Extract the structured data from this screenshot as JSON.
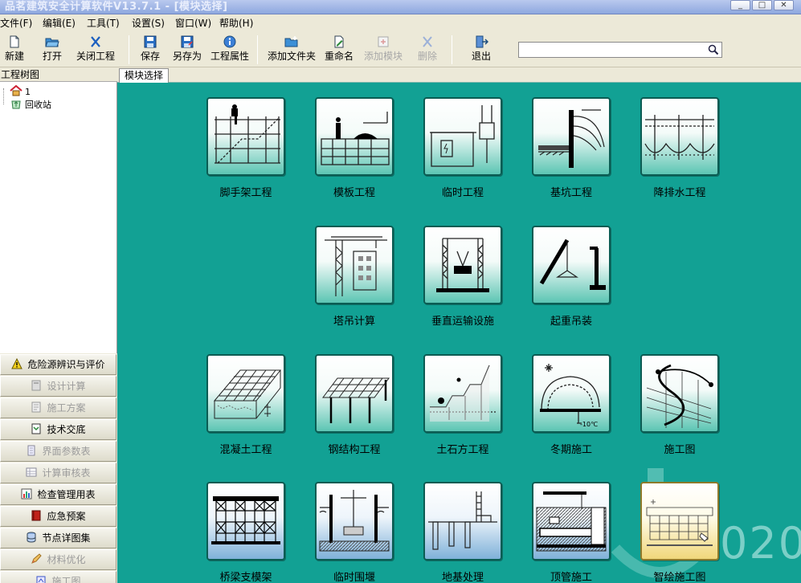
{
  "window": {
    "title": "品茗建筑安全计算软件V13.7.1 - [模块选择]",
    "controls": [
      "_",
      "□",
      "✕"
    ]
  },
  "menu": [
    "文件(F)",
    "编辑(E)",
    "工具(T)",
    "设置(S)",
    "窗口(W)",
    "帮助(H)"
  ],
  "toolbar": {
    "new": "新建",
    "open": "打开",
    "close_project": "关闭工程",
    "save": "保存",
    "save_as": "另存为",
    "properties": "工程属性",
    "add_folder": "添加文件夹",
    "rename": "重命名",
    "add_module": "添加模块",
    "delete": "删除",
    "exit": "退出"
  },
  "search": {
    "value": "",
    "placeholder": ""
  },
  "tree": {
    "header": "工程树图",
    "nodes": [
      "1",
      "回收站"
    ]
  },
  "nav": [
    {
      "label": "危险源辨识与评价",
      "enabled": true,
      "icon": "warning-icon"
    },
    {
      "label": "设计计算",
      "enabled": false,
      "icon": "calculator-icon"
    },
    {
      "label": "施工方案",
      "enabled": false,
      "icon": "plan-icon"
    },
    {
      "label": "技术交底",
      "enabled": true,
      "icon": "document-icon"
    },
    {
      "label": "界面参数表",
      "enabled": false,
      "icon": "scroll-icon"
    },
    {
      "label": "计算审核表",
      "enabled": false,
      "icon": "table-icon"
    },
    {
      "label": "检查管理用表",
      "enabled": true,
      "icon": "chart-icon"
    },
    {
      "label": "应急预案",
      "enabled": true,
      "icon": "book-icon"
    },
    {
      "label": "节点详图集",
      "enabled": true,
      "icon": "database-icon"
    },
    {
      "label": "材料优化",
      "enabled": false,
      "icon": "pencil-icon"
    },
    {
      "label": "施工图",
      "enabled": false,
      "icon": "drawing-icon"
    }
  ],
  "tab": {
    "label": "模块选择"
  },
  "modules": [
    {
      "label": "脚手架工程",
      "icon": "scaffold-icon",
      "style": "green"
    },
    {
      "label": "模板工程",
      "icon": "formwork-icon",
      "style": "green"
    },
    {
      "label": "临时工程",
      "icon": "temporary-works-icon",
      "style": "green"
    },
    {
      "label": "基坑工程",
      "icon": "foundation-pit-icon",
      "style": "green"
    },
    {
      "label": "降排水工程",
      "icon": "dewatering-icon",
      "style": "green"
    },
    {
      "label": "塔吊计算",
      "icon": "tower-crane-icon",
      "style": "green"
    },
    {
      "label": "垂直运输设施",
      "icon": "hoist-icon",
      "style": "green"
    },
    {
      "label": "起重吊装",
      "icon": "lifting-icon",
      "style": "green"
    },
    {
      "label": "混凝土工程",
      "icon": "concrete-icon",
      "style": "green"
    },
    {
      "label": "钢结构工程",
      "icon": "steel-structure-icon",
      "style": "green"
    },
    {
      "label": "土石方工程",
      "icon": "earthwork-icon",
      "style": "green"
    },
    {
      "label": "冬期施工",
      "icon": "winter-construction-icon",
      "style": "green"
    },
    {
      "label": "施工图",
      "icon": "construction-drawing-icon",
      "style": "green"
    },
    {
      "label": "桥梁支模架",
      "icon": "bridge-formwork-icon",
      "style": "blue"
    },
    {
      "label": "临时围堰",
      "icon": "cofferdam-icon",
      "style": "blue"
    },
    {
      "label": "地基处理",
      "icon": "ground-treatment-icon",
      "style": "blue"
    },
    {
      "label": "顶管施工",
      "icon": "pipe-jacking-icon",
      "style": "blue"
    },
    {
      "label": "智绘施工图",
      "icon": "smart-drawing-icon",
      "style": "yellow"
    }
  ],
  "winter_temp_label": "-10℃",
  "watermark": "020",
  "colors": {
    "main_bg": "#12a194",
    "tile_green": "#5cc5b3",
    "tile_blue": "#7fb1d9",
    "tile_yellow": "#f0d77a"
  }
}
